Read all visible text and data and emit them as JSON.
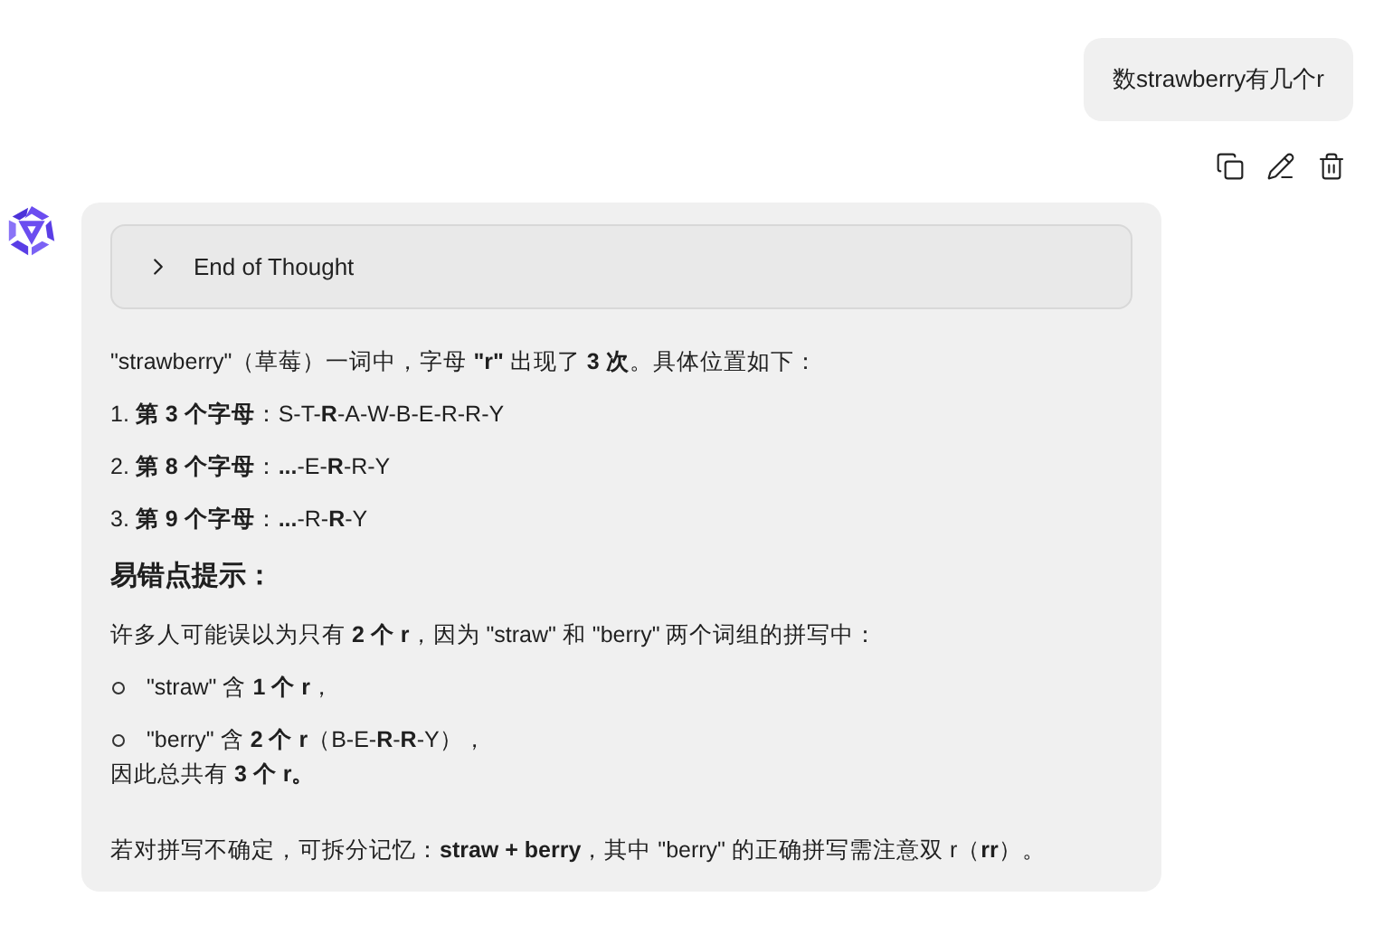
{
  "user_message": {
    "text": "数strawberry有几个r"
  },
  "message_actions": [
    {
      "kind": "copy"
    },
    {
      "kind": "edit"
    },
    {
      "kind": "delete"
    }
  ],
  "assistant_message": {
    "thought": {
      "label": "End of Thought",
      "expanded": false
    },
    "intro": "\"strawberry\"（草莓）一词中，字母 **\"r\"** 出现了 **3 次**。具体位置如下：",
    "positions": [
      {
        "number": "1.",
        "text": "**第 3 个字母**：S-T-**R**-A-W-B-E-R-R-Y"
      },
      {
        "number": "2.",
        "text": "**第 8 个字母**：**...**-E-**R**-R-Y"
      },
      {
        "number": "3.",
        "text": "**第 9 个字母**：**...**-R-**R**-Y"
      }
    ],
    "heading": "易错点提示：",
    "explanation": "许多人可能误以为只有 **2 个 r**，因为 \"straw\" 和 \"berry\" 两个词组的拼写中：",
    "bullets": [
      "\"straw\" 含 **1 个 r**，",
      "\"berry\" 含 **2 个 r**（B-E-**R**-**R**-Y），"
    ],
    "conclusion": "因此总共有 **3 个 r。**",
    "tip": "若对拼写不确定，可拆分记忆：**straw + berry**，其中 \"berry\" 的正确拼写需注意双 r（**rr**）。"
  }
}
